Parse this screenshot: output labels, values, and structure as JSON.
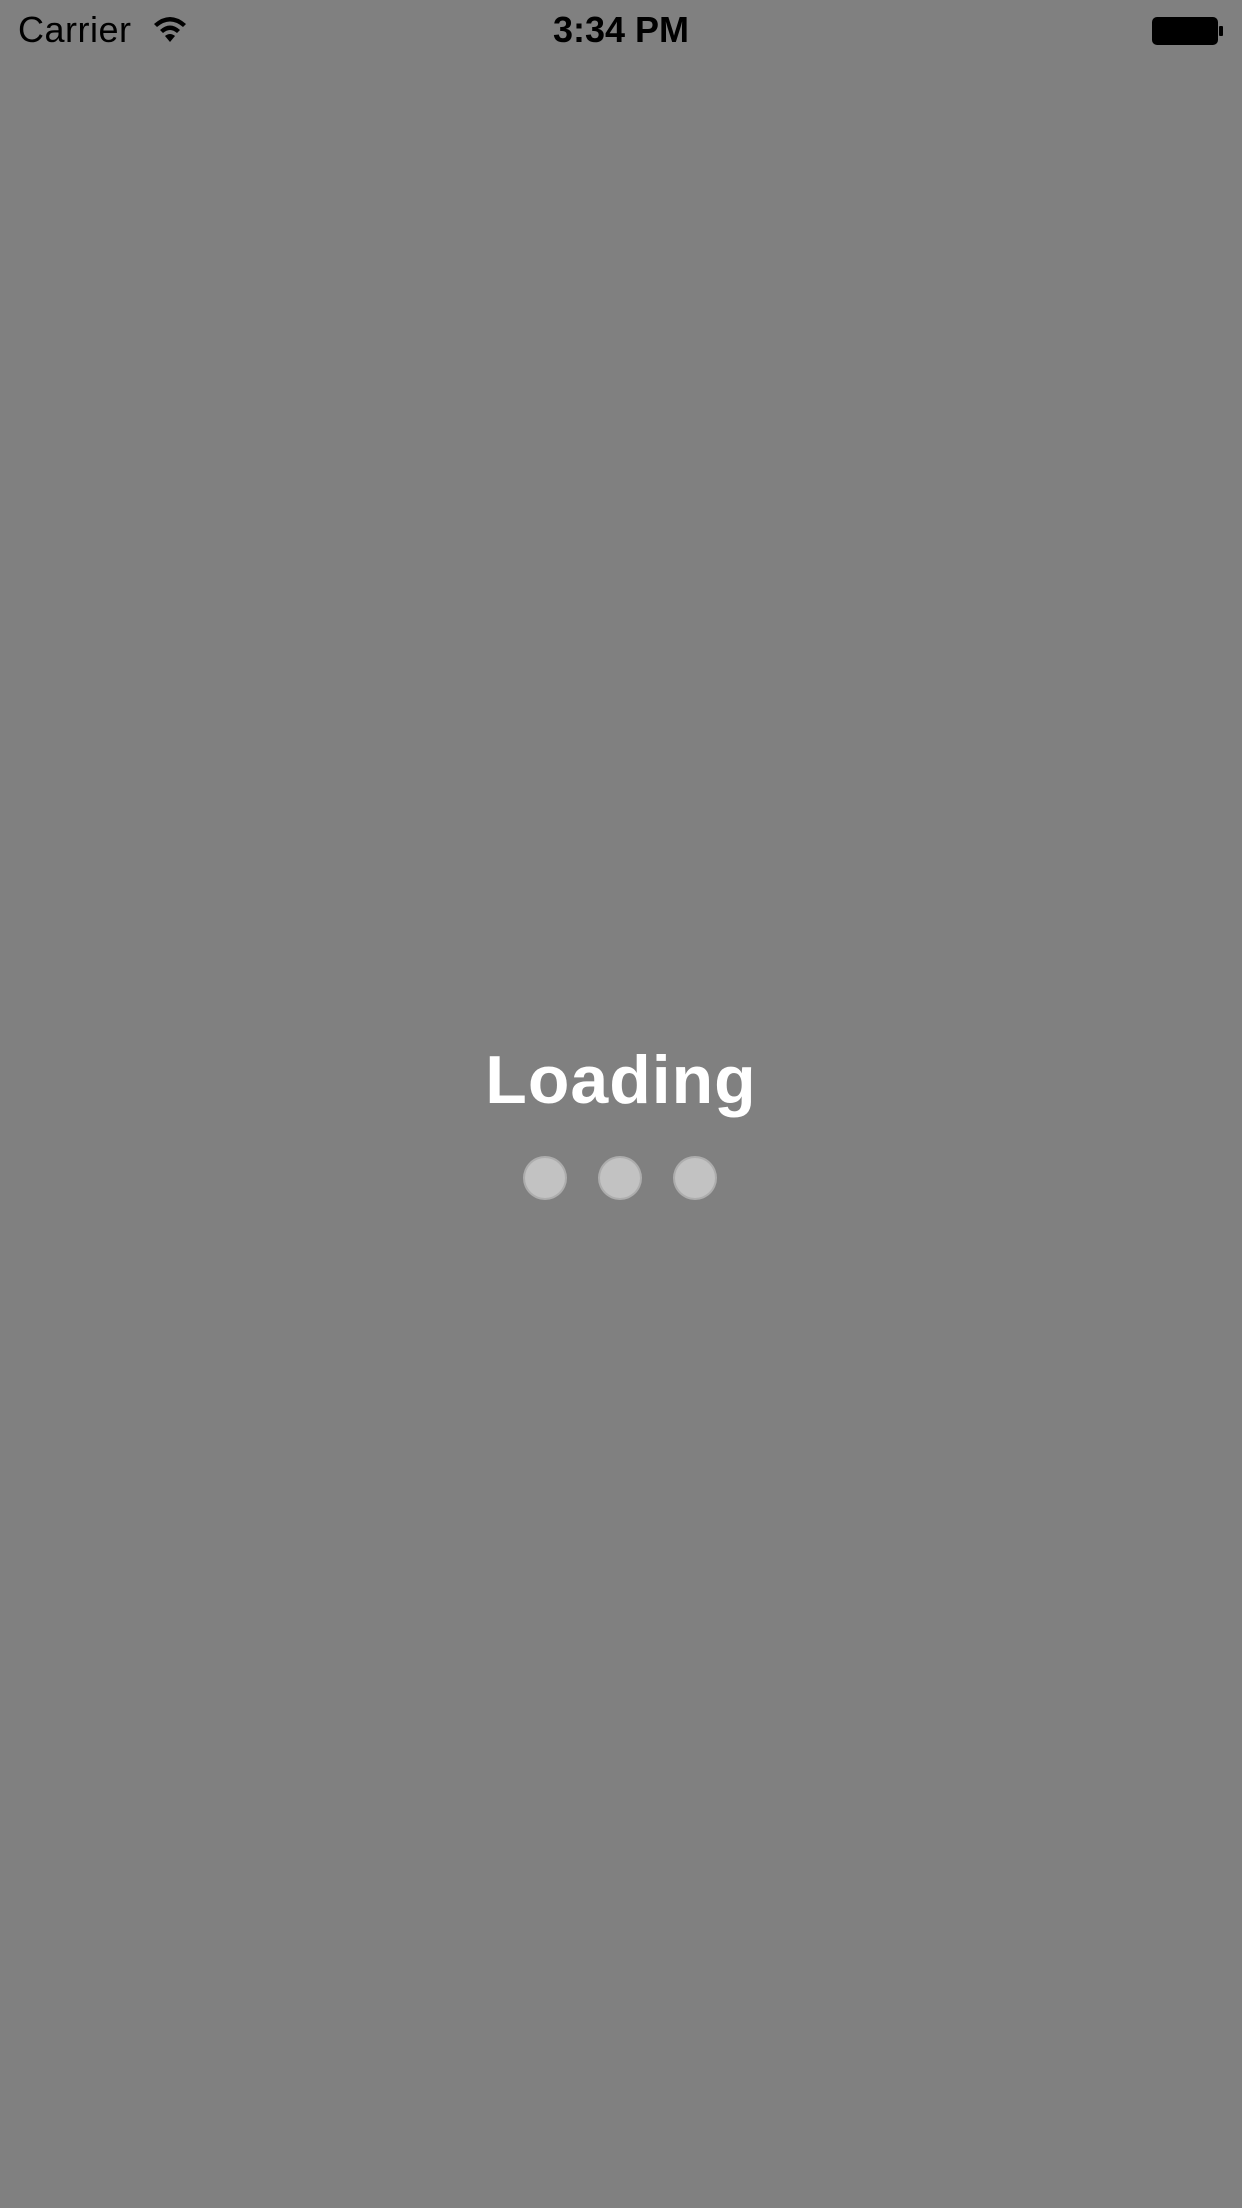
{
  "status_bar": {
    "carrier": "Carrier",
    "time": "3:34 PM",
    "icons": [
      "wifi-icon",
      "battery-icon"
    ]
  },
  "loading": {
    "title": "Loading",
    "indicator": "three-dot-loading-indicator"
  },
  "colors": {
    "background": "#808080",
    "title_text": "#ffffff",
    "dot": "#c2c2c2",
    "status_text": "#000000"
  }
}
